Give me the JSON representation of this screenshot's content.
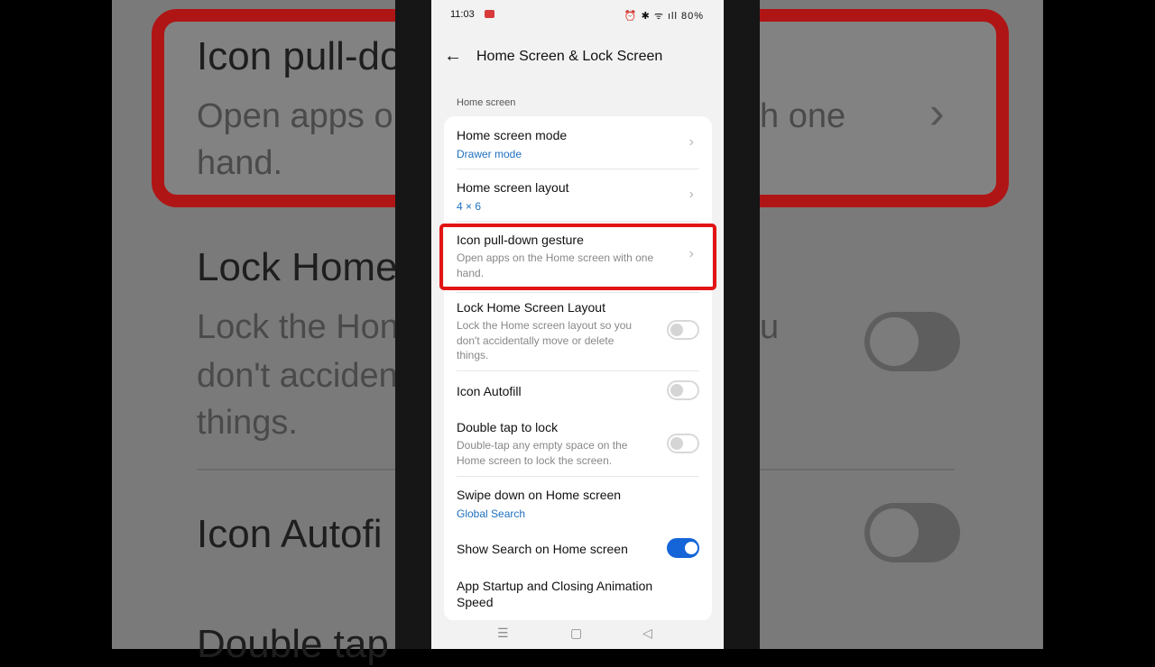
{
  "status_bar": {
    "time": "11:03",
    "icons": "⏰ ✱ ᯤ ıll",
    "battery": "80%"
  },
  "header": {
    "title": "Home Screen & Lock Screen"
  },
  "section": {
    "label": "Home screen"
  },
  "rows": [
    {
      "title": "Home screen mode",
      "value": "Drawer mode"
    },
    {
      "title": "Home screen layout",
      "value": "4 × 6"
    },
    {
      "title": "Icon pull-down gesture",
      "subtitle_lines": [
        "Open apps on the Home screen with one",
        "hand."
      ]
    },
    {
      "title": "Lock Home Screen Layout",
      "subtitle_lines": [
        "Lock the Home screen layout so you",
        "don't accidentally move or delete",
        "things."
      ],
      "toggle_on": false
    },
    {
      "title": "Icon Autofill",
      "toggle_on": false
    },
    {
      "title": "Double tap to lock",
      "subtitle_lines": [
        "Double-tap any empty space on the",
        "Home screen to lock the screen."
      ],
      "toggle_on": false
    },
    {
      "title": "Swipe down on Home screen",
      "value": "Global Search"
    },
    {
      "title": "Show Search on Home screen",
      "toggle_on": true
    },
    {
      "title_lines": [
        "App Startup and Closing Animation",
        "Speed"
      ]
    }
  ],
  "background_zoom": {
    "card_title": "Icon pull-do",
    "card_sub_lines": [
      "Open apps o",
      "h one",
      "hand."
    ],
    "lock_title": "Lock Home",
    "lock_sub_lines": [
      "Lock the Hon",
      "u",
      "don't acciden",
      "things."
    ],
    "autofill_title": "Icon Autofi",
    "double_tap_title": "Double tap"
  },
  "colors": {
    "accent": "#1565d8",
    "link": "#1f6fbf",
    "highlight": "#e21414"
  }
}
